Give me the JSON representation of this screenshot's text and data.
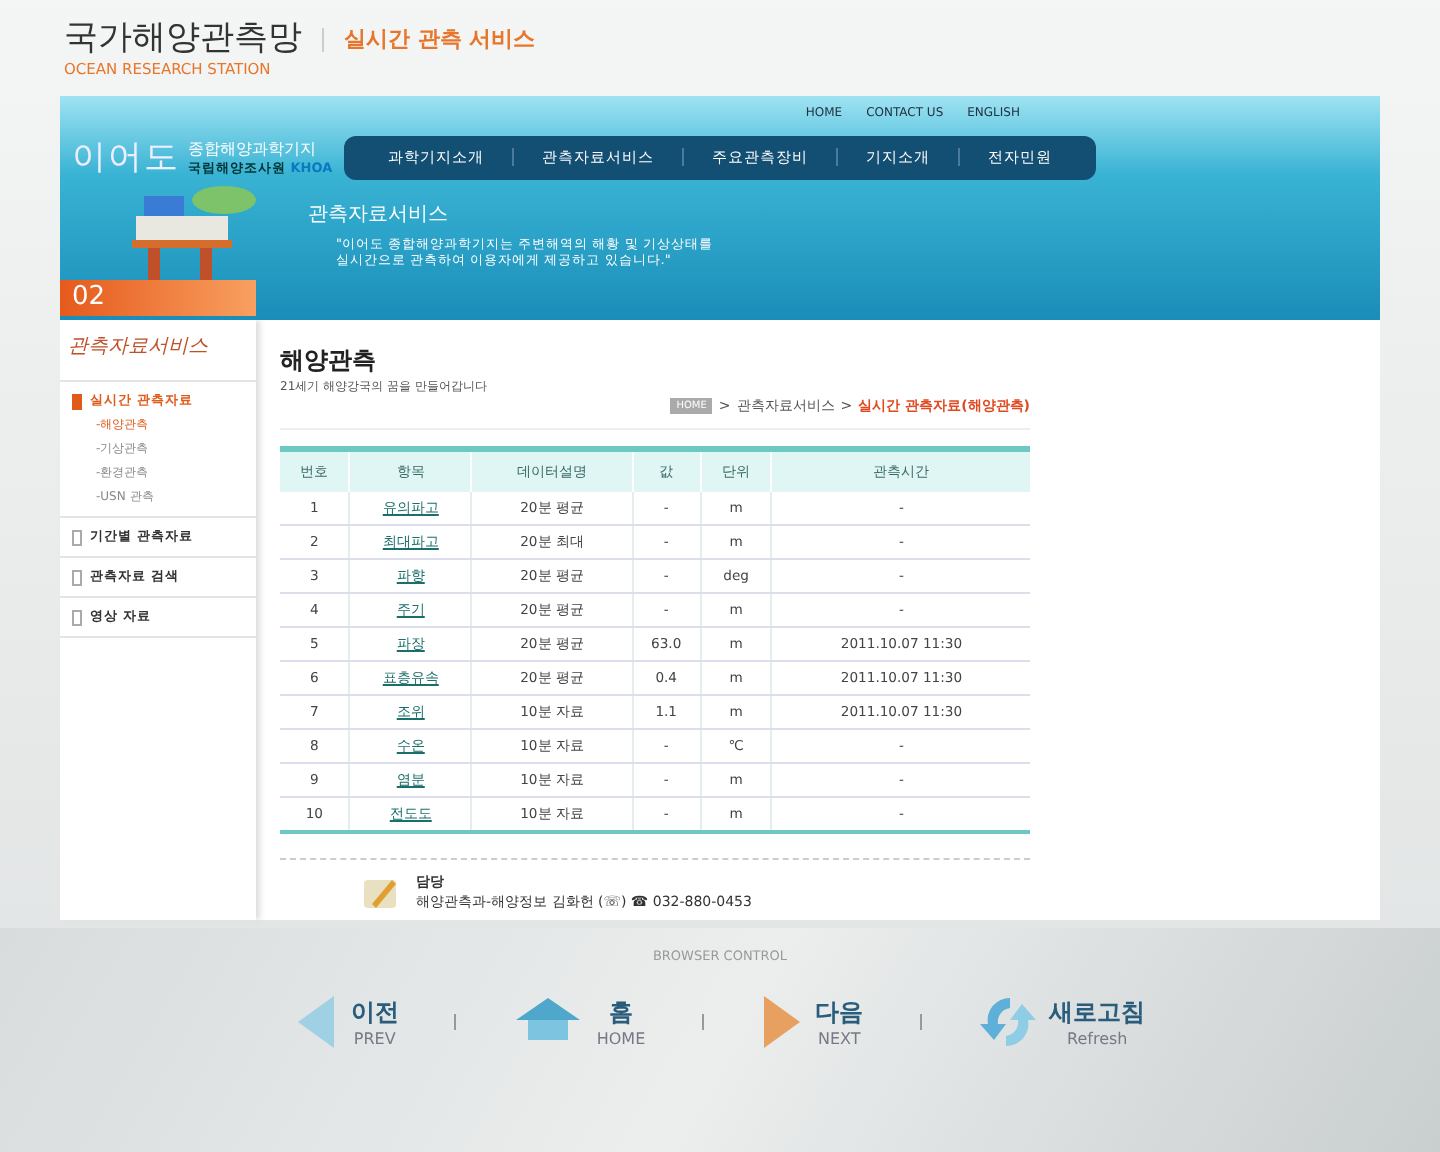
{
  "header": {
    "title": "국가해양관측망",
    "subtitle": "실시간 관측 서비스",
    "english": "OCEAN RESEARCH STATION"
  },
  "top_links": [
    "HOME",
    "CONTACT US",
    "ENGLISH"
  ],
  "banner": {
    "logo_text": "이어도",
    "logo_subtitle": "종합해양과학기지",
    "agency": "국립해양조사원",
    "agency_code": "KHOA",
    "heading": "관측자료서비스",
    "quote": "\"이어도 종합해양과학기지는 주변해역의 해황 및 기상상태를 실시간으로 관측하여 이용자에게 제공하고 있습니다.\""
  },
  "main_nav": [
    "과학기지소개",
    "관측자료서비스",
    "주요관측장비",
    "기지소개",
    "전자민원"
  ],
  "sidebar": {
    "number": "02",
    "title": "관측자료서비스",
    "items": [
      {
        "label": "실시간 관측자료",
        "selected": true,
        "children": [
          {
            "label": "-해양관측",
            "selected": true
          },
          {
            "label": "-기상관측",
            "selected": false
          },
          {
            "label": "-환경관측",
            "selected": false
          },
          {
            "label": "-USN 관측",
            "selected": false
          }
        ]
      },
      {
        "label": "기간별 관측자료",
        "selected": false
      },
      {
        "label": "관측자료 검색",
        "selected": false
      },
      {
        "label": "영상 자료",
        "selected": false
      }
    ]
  },
  "content": {
    "title": "해양관측",
    "subtitle": "21세기 해양강국의 꿈을 만들어갑니다",
    "breadcrumb_separator": ">",
    "breadcrumb": [
      {
        "kind": "badge",
        "label": "HOME"
      },
      {
        "kind": "link",
        "label": "관측자료서비스"
      },
      {
        "kind": "current",
        "label": "실시간 관측자료(해양관측)"
      }
    ]
  },
  "table": {
    "columns": [
      "번호",
      "항목",
      "데이터설명",
      "값",
      "단위",
      "관측시간"
    ],
    "rows": [
      [
        "1",
        "유의파고",
        "20분 평균",
        "-",
        "m",
        "-"
      ],
      [
        "2",
        "최대파고",
        "20분 최대",
        "-",
        "m",
        "-"
      ],
      [
        "3",
        "파향",
        "20분 평균",
        "-",
        "deg",
        "-"
      ],
      [
        "4",
        "주기",
        "20분 평균",
        "-",
        "m",
        "-"
      ],
      [
        "5",
        "파장",
        "20분 평균",
        "63.0",
        "m",
        "2011.10.07 11:30"
      ],
      [
        "6",
        "표층유속",
        "20분 평균",
        "0.4",
        "m",
        "2011.10.07 11:30"
      ],
      [
        "7",
        "조위",
        "10분 자료",
        "1.1",
        "m",
        "2011.10.07 11:30"
      ],
      [
        "8",
        "수온",
        "10분 자료",
        "-",
        "℃",
        "-"
      ],
      [
        "9",
        "염분",
        "10분 자료",
        "-",
        "m",
        "-"
      ],
      [
        "10",
        "전도도",
        "10분 자료",
        "-",
        "m",
        "-"
      ]
    ]
  },
  "contact": {
    "label": "담당",
    "text": "해양관측과-해양정보 김화헌 (☏) ☎ 032-880-0453"
  },
  "browser_control": {
    "title": "BROWSER CONTROL",
    "buttons": [
      {
        "kind": "prev",
        "label": "이전",
        "sub": "PREV"
      },
      {
        "kind": "home",
        "label": "홈",
        "sub": "HOME"
      },
      {
        "kind": "next",
        "label": "다음",
        "sub": "NEXT"
      },
      {
        "kind": "refresh",
        "label": "새로고침",
        "sub": "Refresh"
      }
    ]
  }
}
